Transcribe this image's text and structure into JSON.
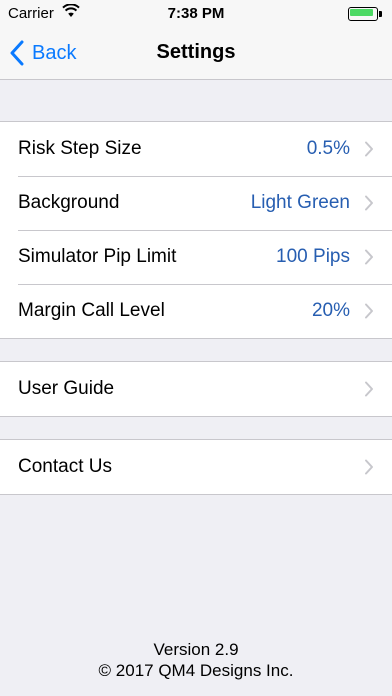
{
  "status_bar": {
    "carrier": "Carrier",
    "time": "7:38 PM",
    "battery_level": 0.9,
    "battery_color": "#4cd964"
  },
  "nav": {
    "back_label": "Back",
    "title": "Settings",
    "accent_color": "#0a7aff"
  },
  "settings": [
    {
      "label": "Risk Step Size",
      "value": "0.5%"
    },
    {
      "label": "Background",
      "value": "Light Green"
    },
    {
      "label": "Simulator Pip Limit",
      "value": "100 Pips"
    },
    {
      "label": "Margin Call Level",
      "value": "20%"
    }
  ],
  "guide": {
    "label": "User Guide"
  },
  "contact": {
    "label": "Contact Us"
  },
  "footer": {
    "version": "Version 2.9",
    "copyright": "© 2017 QM4 Designs Inc."
  }
}
